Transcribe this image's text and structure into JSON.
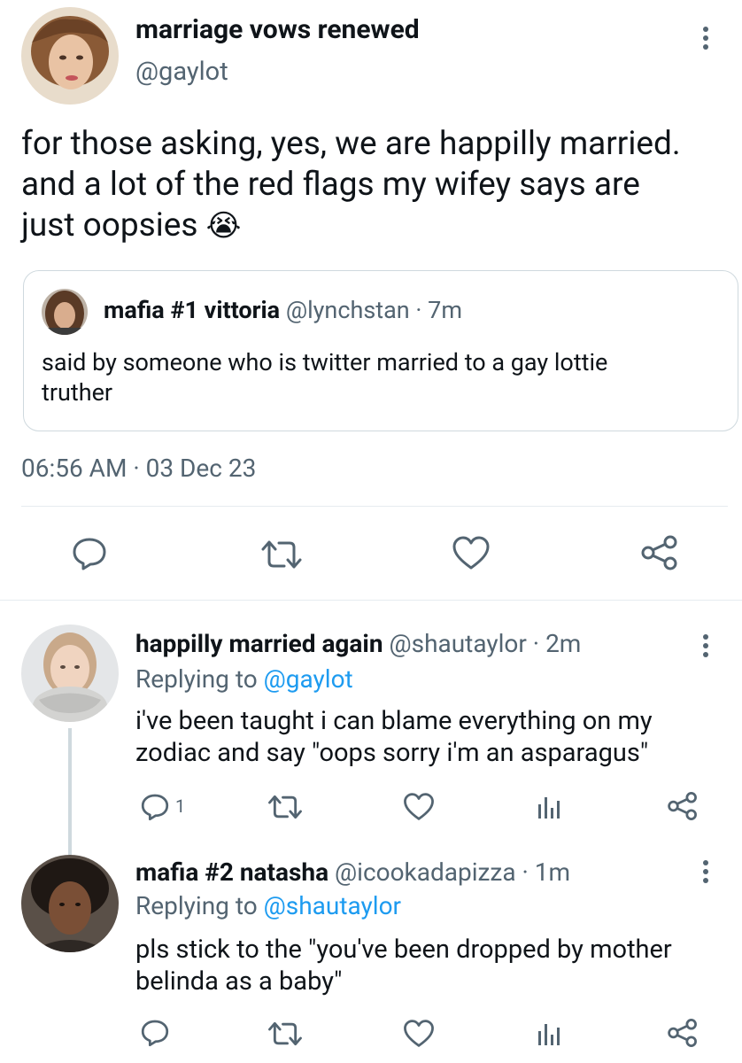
{
  "main_tweet": {
    "display_name": "marriage vows renewed",
    "handle": "@gaylot",
    "text_line1": "for those asking, yes, we are happilly married.",
    "text_line2": "and a lot of the red flags my wifey says are",
    "text_line3": "just oopsies",
    "emoji": "😭",
    "timestamp": "06:56 AM · 03 Dec 23",
    "quoted": {
      "display_name": "mafia #1 vittoria",
      "handle_time": "@lynchstan · 7m",
      "text_line1": "said by someone who is twitter married to a gay lottie",
      "text_line2": "truther"
    }
  },
  "replies": [
    {
      "display_name": "happilly married again",
      "handle_time": "@shautaylor · 2m",
      "replying_prefix": "Replying to",
      "replying_to": "@gaylot",
      "text_line1": "i've been taught i can blame everything on my",
      "text_line2": "zodiac and say \"oops sorry i'm an asparagus\"",
      "reply_count": "1"
    },
    {
      "display_name": "mafia #2 natasha",
      "handle_time": "@icookadapizza · 1m",
      "replying_prefix": "Replying to",
      "replying_to": "@shautaylor",
      "text_line1": "pls stick to the \"you've been dropped by mother",
      "text_line2": "belinda as a baby\""
    }
  ],
  "colors": {
    "text": "#0f1419",
    "muted": "#536471",
    "link": "#1d9bf0",
    "border": "#cfd9de"
  },
  "icons": [
    "reply-icon",
    "retweet-icon",
    "like-icon",
    "share-icon",
    "analytics-icon",
    "more-icon"
  ]
}
